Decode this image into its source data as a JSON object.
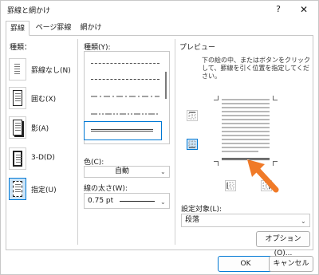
{
  "window": {
    "title": "罫線と網かけ",
    "help_label": "?",
    "close_label": "✕"
  },
  "tabs": [
    {
      "label": "罫線",
      "active": true
    },
    {
      "label": "ページ罫線",
      "active": false
    },
    {
      "label": "網かけ",
      "active": false
    }
  ],
  "setting": {
    "heading": "種類：",
    "items": [
      {
        "label": "罫線なし(N)",
        "icon": "page-no-border-icon"
      },
      {
        "label": "囲む(X)",
        "icon": "page-box-border-icon"
      },
      {
        "label": "影(A)",
        "icon": "page-shadow-border-icon"
      },
      {
        "label": "3-D(D)",
        "icon": "page-3d-border-icon"
      },
      {
        "label": "指定(U)",
        "icon": "page-custom-border-icon",
        "selected": true
      }
    ]
  },
  "style": {
    "heading": "種類(Y):",
    "options": [
      "dashed-fine",
      "dashed-medium",
      "dash-dot",
      "dash-dot-dot",
      "solid-double"
    ],
    "selected_index": 4
  },
  "color": {
    "label": "色(C):",
    "value": "自動"
  },
  "width": {
    "label": "線の太さ(W):",
    "value": "0.75 pt"
  },
  "preview": {
    "heading": "プレビュー",
    "instructions": "下の絵の中、またはボタンをクリックして、罫線を引く位置を指定してください。"
  },
  "apply_to": {
    "label": "設定対象(L):",
    "value": "段落"
  },
  "buttons": {
    "options": "オプション(O)...",
    "ok": "OK",
    "cancel": "キャンセル"
  },
  "colors": {
    "accent": "#0078d4",
    "arrow": "#f07a28"
  }
}
